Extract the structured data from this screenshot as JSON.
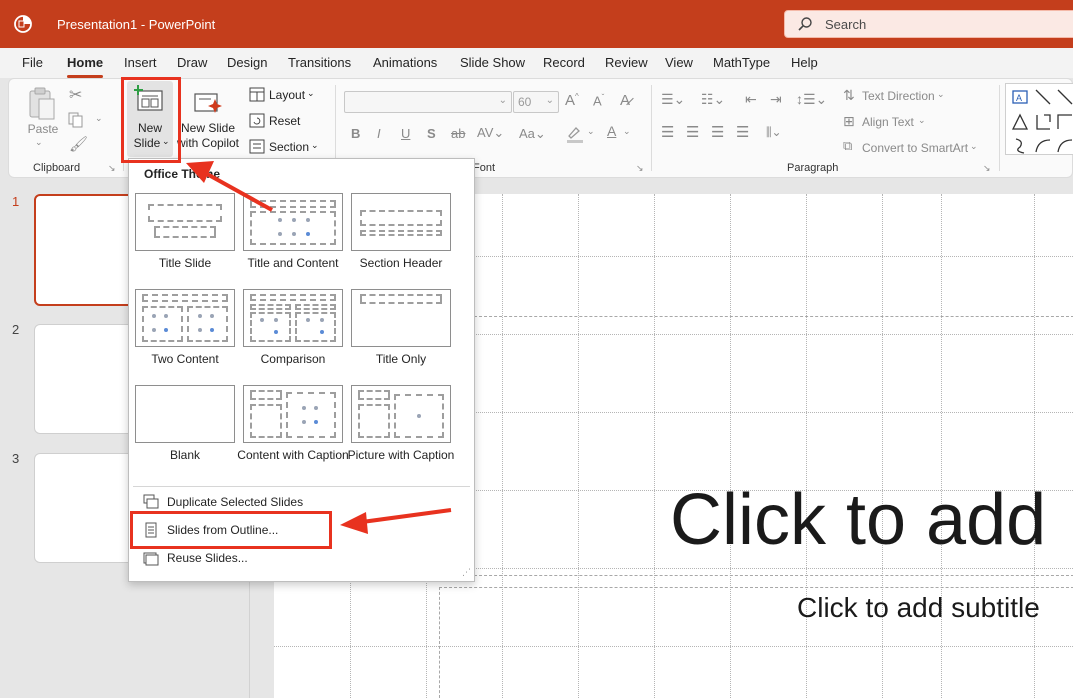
{
  "window": {
    "title": "Presentation1  -  PowerPoint"
  },
  "search": {
    "placeholder": "Search"
  },
  "tabs": [
    "File",
    "Home",
    "Insert",
    "Draw",
    "Design",
    "Transitions",
    "Animations",
    "Slide Show",
    "Record",
    "Review",
    "View",
    "MathType",
    "Help"
  ],
  "active_tab": "Home",
  "ribbon": {
    "clipboard": {
      "label": "Clipboard",
      "paste": "Paste"
    },
    "slides": {
      "new_slide_line1": "New",
      "new_slide_line2": "Slide",
      "copilot_line1": "New Slide",
      "copilot_line2": "with Copilot",
      "layout": "Layout",
      "reset": "Reset",
      "section": "Section"
    },
    "font": {
      "label": "Font",
      "font_size": "60"
    },
    "paragraph": {
      "label": "Paragraph",
      "text_direction": "Text Direction",
      "align_text": "Align Text",
      "convert_smartart": "Convert to SmartArt"
    }
  },
  "slides_pane": {
    "numbers": [
      "1",
      "2",
      "3"
    ]
  },
  "slide": {
    "title_placeholder": "Click to add",
    "subtitle_placeholder": "Click to add subtitle"
  },
  "new_slide_menu": {
    "header": "Office Theme",
    "layouts": [
      "Title Slide",
      "Title and Content",
      "Section Header",
      "Two Content",
      "Comparison",
      "Title Only",
      "Blank",
      "Content with Caption",
      "Picture with Caption"
    ],
    "commands": [
      "Duplicate Selected Slides",
      "Slides from Outline...",
      "Reuse Slides..."
    ]
  },
  "colors": {
    "accent": "#c43e1c",
    "annotation": "#e8321f"
  }
}
